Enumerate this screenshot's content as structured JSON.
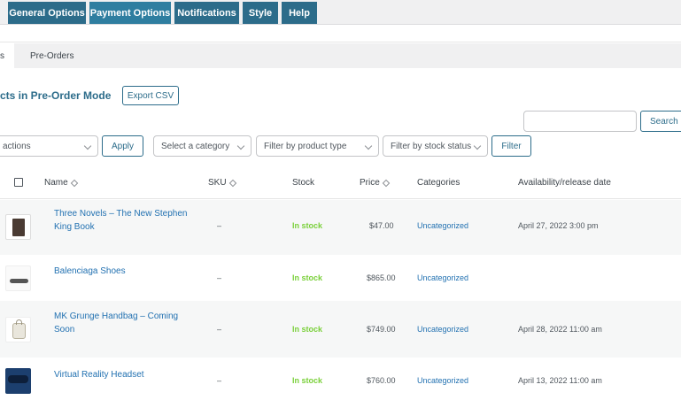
{
  "nav_tabs": [
    {
      "label": "General Options"
    },
    {
      "label": "Payment Options"
    },
    {
      "label": "Notifications"
    },
    {
      "label": "Style"
    },
    {
      "label": "Help"
    }
  ],
  "sub_tabs": [
    {
      "label": "s"
    },
    {
      "label": "Pre-Orders"
    }
  ],
  "heading": "cts in Pre-Order Mode",
  "export_button": "Export CSV",
  "search_button": "Search p",
  "bulk": {
    "value": "actions",
    "apply": "Apply"
  },
  "filters": {
    "category": "Select a category",
    "product_type": "Filter by product type",
    "stock_status": "Filter by stock status",
    "button": "Filter"
  },
  "columns": {
    "name": "Name",
    "sku": "SKU",
    "stock": "Stock",
    "price": "Price",
    "categories": "Categories",
    "availability": "Availability/release date"
  },
  "rows": [
    {
      "name_l1": "Three Novels – The New Stephen",
      "name_l2": "King Book",
      "sku": "–",
      "stock": "In stock",
      "price": "$47.00",
      "category": "Uncategorized",
      "date": "April 27, 2022 3:00 pm"
    },
    {
      "name_l1": "Balenciaga Shoes",
      "name_l2": "",
      "sku": "–",
      "stock": "In stock",
      "price": "$865.00",
      "category": "Uncategorized",
      "date": ""
    },
    {
      "name_l1": "MK Grunge Handbag – Coming",
      "name_l2": "Soon",
      "sku": "–",
      "stock": "In stock",
      "price": "$749.00",
      "category": "Uncategorized",
      "date": "April 28, 2022 11:00 am"
    },
    {
      "name_l1": "Virtual Reality Headset",
      "name_l2": "",
      "sku": "–",
      "stock": "In stock",
      "price": "$760.00",
      "category": "Uncategorized",
      "date": "April 13, 2022 11:00 am"
    }
  ],
  "colors": {
    "accent": "#2c6c8a",
    "stock": "#7ad03a",
    "link": "#2271b1"
  }
}
